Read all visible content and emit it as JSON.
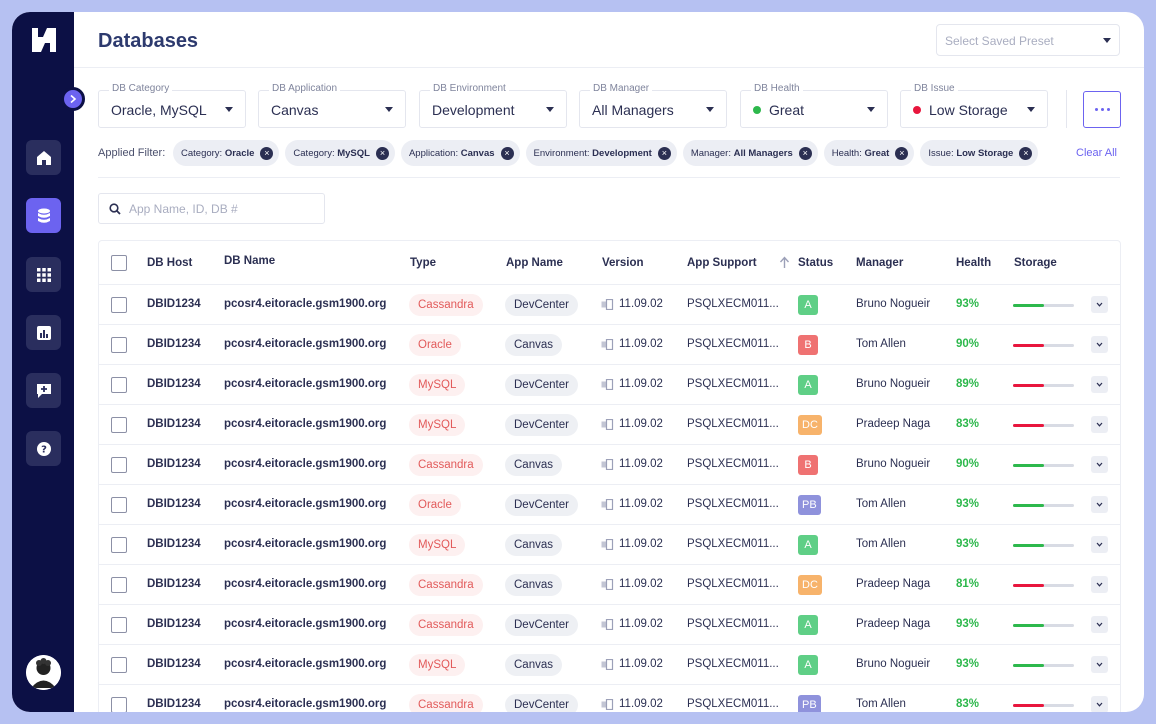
{
  "page_title": "Databases",
  "preset_placeholder": "Select Saved Preset",
  "filters": [
    {
      "label": "DB Category",
      "value": "Oracle, MySQL"
    },
    {
      "label": "DB Application",
      "value": "Canvas"
    },
    {
      "label": "DB Environment",
      "value": "Development"
    },
    {
      "label": "DB Manager",
      "value": "All Managers"
    },
    {
      "label": "DB Health",
      "value": "Great",
      "dot_color": "#2db84c"
    },
    {
      "label": "DB Issue",
      "value": "Low Storage",
      "dot_color": "#e8163d"
    }
  ],
  "applied_filter_label": "Applied Filter:",
  "applied_chips": [
    {
      "key": "Category:",
      "value": "Oracle"
    },
    {
      "key": "Category:",
      "value": "MySQL"
    },
    {
      "key": "Application:",
      "value": "Canvas"
    },
    {
      "key": "Environment:",
      "value": "Development"
    },
    {
      "key": "Manager:",
      "value": "All Managers"
    },
    {
      "key": "Health:",
      "value": "Great"
    },
    {
      "key": "Issue:",
      "value": "Low Storage"
    }
  ],
  "clear_all": "Clear All",
  "search_placeholder": "App Name, ID, DB #",
  "columns": {
    "db_host": "DB Host",
    "db_name": "DB Name",
    "type": "Type",
    "app_name": "App Name",
    "version": "Version",
    "app_support": "App Support",
    "status": "Status",
    "manager": "Manager",
    "health": "Health",
    "storage": "Storage"
  },
  "status_colors": {
    "A": "#5fcf86",
    "B": "#ef7272",
    "DC": "#f7b36b",
    "PB": "#8f92dc"
  },
  "storage_colors": {
    "ok": "#2db84c",
    "low": "#e8163d"
  },
  "rows": [
    {
      "host": "DBID1234",
      "name": "pcosr4.eitoracle.gsm1900.org",
      "type": "Cassandra",
      "app": "DevCenter",
      "version": "11.09.02",
      "support": "PSQLXECM011...",
      "status": "A",
      "manager": "Bruno Nogueir",
      "health": "93%",
      "storage": 0.5,
      "storage_state": "ok"
    },
    {
      "host": "DBID1234",
      "name": "pcosr4.eitoracle.gsm1900.org",
      "type": "Oracle",
      "app": "Canvas",
      "version": "11.09.02",
      "support": "PSQLXECM011...",
      "status": "B",
      "manager": "Tom Allen",
      "health": "90%",
      "storage": 0.5,
      "storage_state": "low"
    },
    {
      "host": "DBID1234",
      "name": "pcosr4.eitoracle.gsm1900.org",
      "type": "MySQL",
      "app": "DevCenter",
      "version": "11.09.02",
      "support": "PSQLXECM011...",
      "status": "A",
      "manager": "Bruno Nogueir",
      "health": "89%",
      "storage": 0.5,
      "storage_state": "low"
    },
    {
      "host": "DBID1234",
      "name": "pcosr4.eitoracle.gsm1900.org",
      "type": "MySQL",
      "app": "DevCenter",
      "version": "11.09.02",
      "support": "PSQLXECM011...",
      "status": "DC",
      "manager": "Pradeep Naga",
      "health": "83%",
      "storage": 0.5,
      "storage_state": "low"
    },
    {
      "host": "DBID1234",
      "name": "pcosr4.eitoracle.gsm1900.org",
      "type": "Cassandra",
      "app": "Canvas",
      "version": "11.09.02",
      "support": "PSQLXECM011...",
      "status": "B",
      "manager": "Bruno Nogueir",
      "health": "90%",
      "storage": 0.5,
      "storage_state": "ok"
    },
    {
      "host": "DBID1234",
      "name": "pcosr4.eitoracle.gsm1900.org",
      "type": "Oracle",
      "app": "DevCenter",
      "version": "11.09.02",
      "support": "PSQLXECM011...",
      "status": "PB",
      "manager": "Tom Allen",
      "health": "93%",
      "storage": 0.5,
      "storage_state": "ok"
    },
    {
      "host": "DBID1234",
      "name": "pcosr4.eitoracle.gsm1900.org",
      "type": "MySQL",
      "app": "Canvas",
      "version": "11.09.02",
      "support": "PSQLXECM011...",
      "status": "A",
      "manager": "Tom Allen",
      "health": "93%",
      "storage": 0.5,
      "storage_state": "ok"
    },
    {
      "host": "DBID1234",
      "name": "pcosr4.eitoracle.gsm1900.org",
      "type": "Cassandra",
      "app": "Canvas",
      "version": "11.09.02",
      "support": "PSQLXECM011...",
      "status": "DC",
      "manager": "Pradeep Naga",
      "health": "81%",
      "storage": 0.5,
      "storage_state": "low"
    },
    {
      "host": "DBID1234",
      "name": "pcosr4.eitoracle.gsm1900.org",
      "type": "Cassandra",
      "app": "DevCenter",
      "version": "11.09.02",
      "support": "PSQLXECM011...",
      "status": "A",
      "manager": "Pradeep Naga",
      "health": "93%",
      "storage": 0.5,
      "storage_state": "ok"
    },
    {
      "host": "DBID1234",
      "name": "pcosr4.eitoracle.gsm1900.org",
      "type": "MySQL",
      "app": "Canvas",
      "version": "11.09.02",
      "support": "PSQLXECM011...",
      "status": "A",
      "manager": "Bruno Nogueir",
      "health": "93%",
      "storage": 0.5,
      "storage_state": "ok"
    },
    {
      "host": "DBID1234",
      "name": "pcosr4.eitoracle.gsm1900.org",
      "type": "Cassandra",
      "app": "DevCenter",
      "version": "11.09.02",
      "support": "PSQLXECM011...",
      "status": "PB",
      "manager": "Tom Allen",
      "health": "83%",
      "storage": 0.5,
      "storage_state": "low"
    }
  ]
}
